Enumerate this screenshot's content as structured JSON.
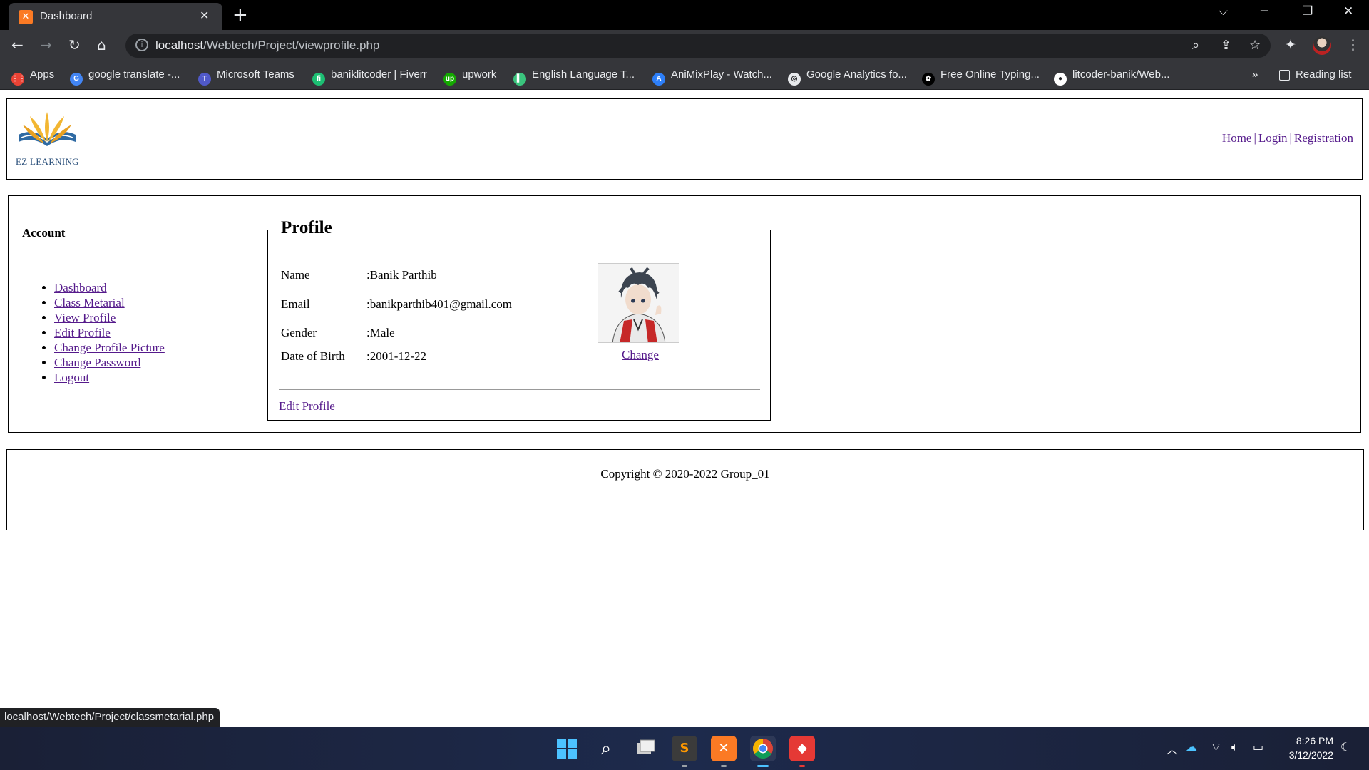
{
  "browser": {
    "tab_title": "Dashboard",
    "tab_favicon_glyph": "⚉",
    "new_tab_glyph": "+",
    "url_host": "localhost",
    "url_path": "/Webtech/Project/viewprofile.php",
    "bookmarks": [
      {
        "label": "Apps",
        "icon": "apps-grid-icon",
        "color": "#ea4335"
      },
      {
        "label": "google translate -...",
        "icon": "google-icon",
        "color": "#4285f4"
      },
      {
        "label": "Microsoft Teams",
        "icon": "teams-icon",
        "color": "#5059c9"
      },
      {
        "label": "baniklitcoder | Fiverr",
        "icon": "fiverr-icon",
        "color": "#1dbf73"
      },
      {
        "label": "upwork",
        "icon": "upwork-icon",
        "color": "#14a800"
      },
      {
        "label": "English Language T...",
        "icon": "english-icon",
        "color": "#3ac47d"
      },
      {
        "label": "AniMixPlay - Watch...",
        "icon": "animixplay-icon",
        "color": "#2d7ff9"
      },
      {
        "label": "Google Analytics fo...",
        "icon": "analytics-icon",
        "color": "#e8eaed"
      },
      {
        "label": "Free Online Typing...",
        "icon": "paw-icon",
        "color": "#000000"
      },
      {
        "label": "litcoder-banik/Web...",
        "icon": "github-icon",
        "color": "#ffffff"
      }
    ],
    "more_bookmarks": "»",
    "reading_list": "Reading list",
    "status_url": "localhost/Webtech/Project/classmetarial.php"
  },
  "site": {
    "logo_text": "EZ LEARNING",
    "nav": {
      "home": "Home",
      "login": "Login",
      "registration": "Registration",
      "separator": "|"
    }
  },
  "sidebar": {
    "heading": "Account",
    "items": [
      {
        "label": "Dashboard"
      },
      {
        "label": "Class Metarial"
      },
      {
        "label": "View Profile"
      },
      {
        "label": "Edit Profile"
      },
      {
        "label": "Change Profile Picture"
      },
      {
        "label": "Change Password"
      },
      {
        "label": "Logout"
      }
    ]
  },
  "profile": {
    "legend": "Profile",
    "rows": [
      {
        "label": "Name",
        "value": ":Banik Parthib"
      },
      {
        "label": "Email",
        "value": ":banikparthib401@gmail.com"
      },
      {
        "label": "Gender",
        "value": ":Male"
      },
      {
        "label": "Date of Birth",
        "value": ":2001-12-22"
      }
    ],
    "change_label": "Change",
    "edit_label": "Edit Profile"
  },
  "footer": {
    "copyright": "Copyright © 2020-2022 Group_01"
  },
  "taskbar": {
    "time": "8:26 PM",
    "date": "3/12/2022"
  },
  "colors": {
    "link_visited": "#551a8b",
    "chrome_dark": "#35363a",
    "taskbar": "#1d2a4c"
  }
}
